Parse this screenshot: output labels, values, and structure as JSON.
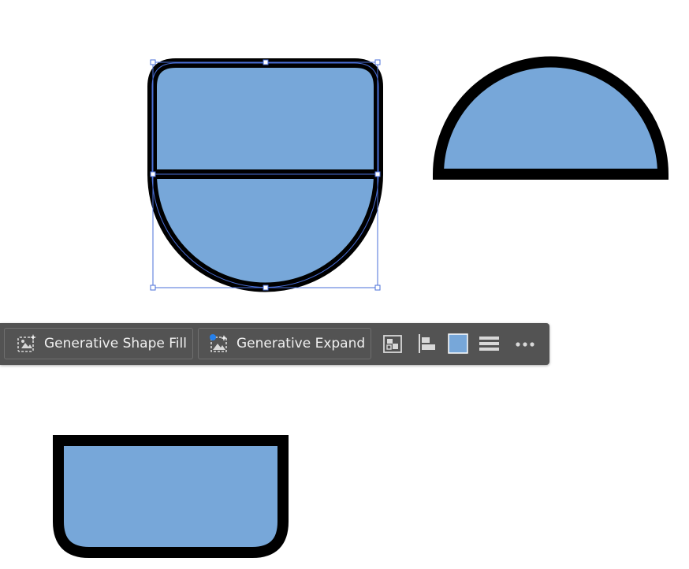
{
  "canvas": {
    "shapes": [
      {
        "name": "split-capsule-shape",
        "fill": "#77a7d9",
        "stroke": "#000000",
        "selected": true
      },
      {
        "name": "half-circle-shape",
        "fill": "#77a7d9",
        "stroke": "#000000",
        "selected": false
      },
      {
        "name": "rounded-bottom-shape",
        "fill": "#77a7d9",
        "stroke": "#000000",
        "selected": false
      }
    ],
    "selection_color": "#4a6fd8"
  },
  "taskbar": {
    "generative_shape_fill_label": "Generative Shape Fill",
    "generative_expand_label": "Generative Expand",
    "fill_swatch_color": "#77a7d9",
    "icons": [
      "arrange-icon",
      "align-left-icon",
      "fill-color-swatch",
      "stroke-lines-icon",
      "more-options-icon"
    ]
  }
}
